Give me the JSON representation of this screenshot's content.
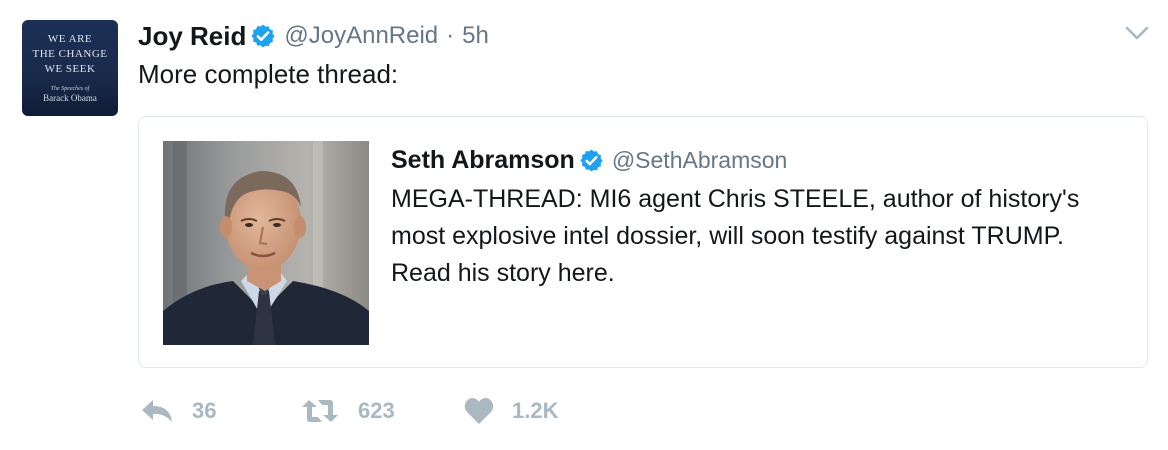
{
  "avatar": {
    "line1": "WE ARE",
    "line2": "THE CHANGE",
    "line3": "WE SEEK",
    "subtitle": "The Speeches of",
    "author": "Barack Obama"
  },
  "tweet": {
    "author_name": "Joy Reid",
    "handle": "@JoyAnnReid",
    "separator": "·",
    "time": "5h",
    "text": "More complete thread:"
  },
  "quoted_tweet": {
    "author_name": "Seth Abramson",
    "handle": "@SethAbramson",
    "text": "MEGA-THREAD: MI6 agent Chris STEELE, author of history's most explosive intel dossier, will soon testify against TRUMP. Read his story here."
  },
  "actions": {
    "reply_count": "36",
    "retweet_count": "623",
    "like_count": "1.2K"
  },
  "colors": {
    "verified_blue": "#1da1f2",
    "secondary_text": "#657786",
    "action_gray": "#aab8c2",
    "border": "#e1e8ed"
  },
  "icons": {
    "verified": "verified-badge-icon",
    "caret": "chevron-down-icon",
    "reply": "reply-icon",
    "retweet": "retweet-icon",
    "like": "heart-icon"
  }
}
